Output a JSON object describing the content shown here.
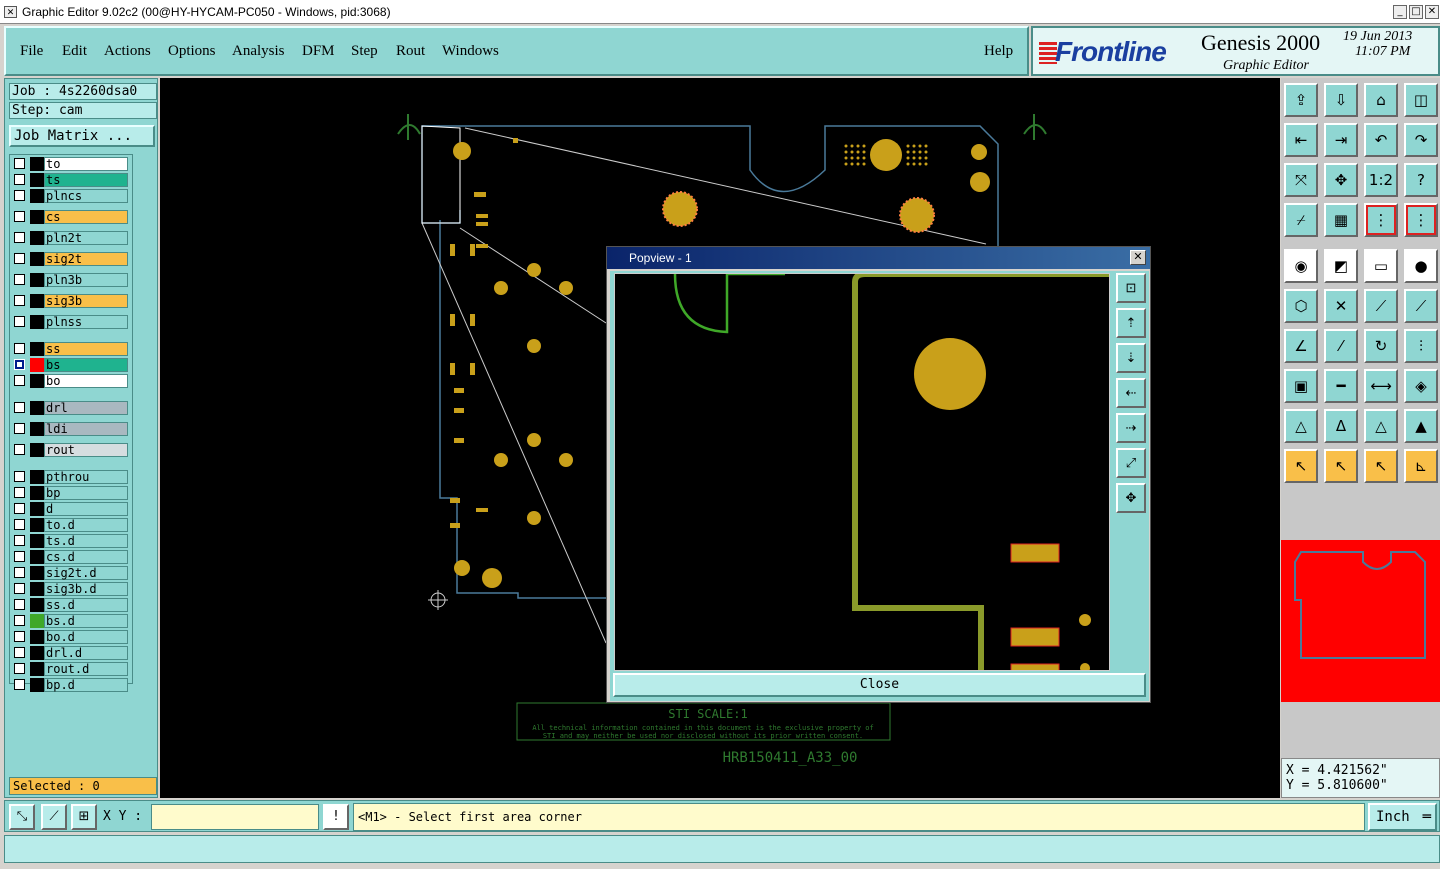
{
  "window": {
    "title": "Graphic Editor 9.02c2 (00@HY-HYCAM-PC050 - Windows, pid:3068)",
    "minimize": "_",
    "maximize": "□",
    "close": "✕"
  },
  "menu": [
    {
      "label": "File"
    },
    {
      "label": "Edit"
    },
    {
      "label": "Actions"
    },
    {
      "label": "Options"
    },
    {
      "label": "Analysis"
    },
    {
      "label": "DFM"
    },
    {
      "label": "Step"
    },
    {
      "label": "Rout"
    },
    {
      "label": "Windows"
    },
    {
      "label": "Help"
    }
  ],
  "brand": {
    "logo": "Frontline",
    "product": "Genesis 2000",
    "subtitle": "Graphic Editor",
    "date": "19 Jun 2013",
    "time": "11:07 PM"
  },
  "job": {
    "job": "Job : 4s2260dsa0",
    "step": "Step: cam",
    "matrix_button": "Job Matrix ..."
  },
  "layers": [
    {
      "name": "to",
      "color": "#ffffff",
      "checked": false
    },
    {
      "name": "ts",
      "color": "#1fb38f",
      "checked": false
    },
    {
      "name": "plncs",
      "color": "#8fd6d2",
      "checked": false
    },
    {
      "name": "cs",
      "color": "#f9bf49",
      "checked": false
    },
    {
      "name": "pln2t",
      "color": "#8fd6d2",
      "checked": false
    },
    {
      "name": "sig2t",
      "color": "#f9bf49",
      "checked": false
    },
    {
      "name": "pln3b",
      "color": "#8fd6d2",
      "checked": false
    },
    {
      "name": "sig3b",
      "color": "#f9bf49",
      "checked": false
    },
    {
      "name": "plnss",
      "color": "#8fd6d2",
      "checked": false
    },
    {
      "name": "ss",
      "color": "#f9bf49",
      "checked": false
    },
    {
      "name": "bs",
      "color": "#1fb38f",
      "checked": true,
      "swatch": "#ff0000"
    },
    {
      "name": "bo",
      "color": "#ffffff",
      "checked": false
    },
    {
      "name": "drl",
      "color": "#a9b8c0",
      "checked": false
    },
    {
      "name": "ldi",
      "color": "#a9b8c0",
      "checked": false
    },
    {
      "name": "rout",
      "color": "#d6dde0",
      "checked": false
    },
    {
      "name": "pthrou",
      "color": "#8fd6d2",
      "checked": false
    },
    {
      "name": "bp",
      "color": "#8fd6d2",
      "checked": false
    },
    {
      "name": "d",
      "color": "#8fd6d2",
      "checked": false
    },
    {
      "name": "to.d",
      "color": "#8fd6d2",
      "checked": false
    },
    {
      "name": "ts.d",
      "color": "#8fd6d2",
      "checked": false
    },
    {
      "name": "cs.d",
      "color": "#8fd6d2",
      "checked": false
    },
    {
      "name": "sig2t.d",
      "color": "#8fd6d2",
      "checked": false
    },
    {
      "name": "sig3b.d",
      "color": "#8fd6d2",
      "checked": false
    },
    {
      "name": "ss.d",
      "color": "#8fd6d2",
      "checked": false
    },
    {
      "name": "bs.d",
      "color": "#8fd6d2",
      "checked": false,
      "swatch": "#3fa828"
    },
    {
      "name": "bo.d",
      "color": "#8fd6d2",
      "checked": false
    },
    {
      "name": "drl.d",
      "color": "#8fd6d2",
      "checked": false
    },
    {
      "name": "rout.d",
      "color": "#8fd6d2",
      "checked": false
    },
    {
      "name": "bp.d",
      "color": "#8fd6d2",
      "checked": false
    }
  ],
  "selected": "Selected : 0",
  "popview": {
    "title": "Popview - 1",
    "close_button": "Close"
  },
  "board_text": {
    "line1": "STI SCALE:1",
    "line2": "All technical information contained in this document is the exclusive property of",
    "line3": "STI and may neither be used nor disclosed without its prior written consent.",
    "part": "HRB150411_A33_00"
  },
  "coords": {
    "x": "X = 4.421562\"",
    "y": "Y = 5.810600\""
  },
  "status": {
    "xy_label": "X Y :",
    "xy_value": "",
    "prompt": "<M1> - Select first area corner",
    "units": "Inch",
    "exclaim": "!"
  },
  "colors": {
    "panel": "#8fd6d2",
    "pad": "#c9a01a",
    "outline": "#4a7a9a",
    "accent": "#f9bf49"
  }
}
